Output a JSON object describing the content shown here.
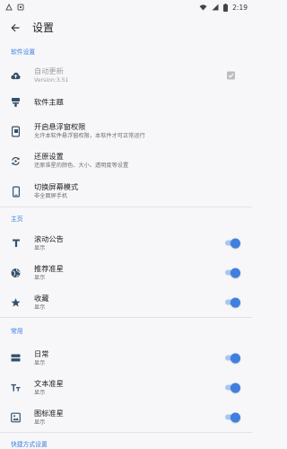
{
  "status_bar": {
    "time": "2:19"
  },
  "app_bar": {
    "title": "设置",
    "back_icon": "arrow-back-icon"
  },
  "colors": {
    "accent": "#3f7fe0",
    "background": "#f7f7f9",
    "icon": "#34506c",
    "toggle_track_on": "#a9c7f1"
  },
  "sections": [
    {
      "header": "软件设置",
      "items": [
        {
          "title": "自动更新",
          "subtitle": "Version:3.51",
          "icon": "cloud-upload-icon",
          "control": "checkbox",
          "checked": true,
          "enabled": false
        },
        {
          "title": "软件主题",
          "icon": "theme-icon"
        },
        {
          "title": "开启悬浮窗权限",
          "subtitle": "允许本软件悬浮窗权限，本软件才可正常运行",
          "icon": "floating-window-icon"
        },
        {
          "title": "还原设置",
          "subtitle": "还原准星的颜色、大小、透明度等设置",
          "icon": "restore-icon"
        },
        {
          "title": "切换屏幕模式",
          "subtitle": "非全面屏手机",
          "icon": "phone-icon"
        }
      ]
    },
    {
      "header": "主页",
      "items": [
        {
          "title": "滚动公告",
          "subtitle": "显示",
          "icon": "text-icon",
          "control": "toggle",
          "on": true
        },
        {
          "title": "推荐准星",
          "subtitle": "显示",
          "icon": "globe-icon",
          "control": "toggle",
          "on": true
        },
        {
          "title": "收藏",
          "subtitle": "显示",
          "icon": "star-icon",
          "control": "toggle",
          "on": true
        }
      ]
    },
    {
      "header": "常用",
      "items": [
        {
          "title": "日常",
          "subtitle": "显示",
          "icon": "view-agenda-icon",
          "control": "toggle",
          "on": true
        },
        {
          "title": "文本准星",
          "subtitle": "显示",
          "icon": "text-format-icon",
          "control": "toggle",
          "on": true
        },
        {
          "title": "图标准星",
          "subtitle": "显示",
          "icon": "image-icon",
          "control": "toggle",
          "on": true
        }
      ]
    },
    {
      "header": "快捷方式设置"
    }
  ]
}
